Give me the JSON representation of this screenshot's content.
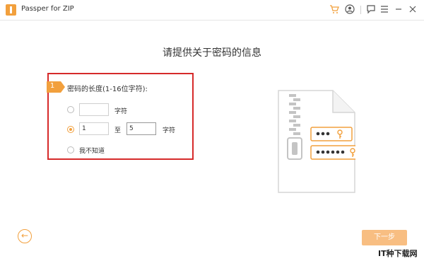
{
  "app": {
    "title": "Passper for ZIP"
  },
  "titlebar": {
    "cart_icon": "cart-icon",
    "account_icon": "account-icon",
    "feedback_icon": "feedback-icon",
    "menu_icon": "menu-icon",
    "close_icon": "close-icon"
  },
  "main": {
    "heading": "请提供关于密码的信息",
    "step": {
      "number": "1",
      "label": "密码的长度(1-16位字符):"
    },
    "options": [
      {
        "selected": false,
        "value": "",
        "unit": "字符"
      },
      {
        "selected": true,
        "from": "1",
        "separator": "至",
        "to": "5",
        "unit": "字符"
      },
      {
        "selected": false,
        "label": "我不知道"
      }
    ]
  },
  "footer": {
    "back_icon": "arrow-left-icon",
    "next_label": "下一步"
  },
  "watermark": "IT种下载网",
  "colors": {
    "accent": "#f2a03d",
    "highlight_border": "#d62a2a",
    "next_button": "#f8be82"
  }
}
